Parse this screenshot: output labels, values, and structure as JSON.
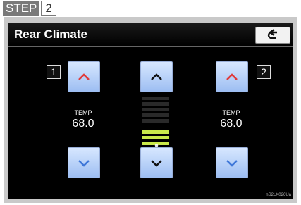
{
  "step": {
    "word": "STEP",
    "number": "2"
  },
  "header": {
    "title": "Rear Climate",
    "back_icon": "back-arrow-icon"
  },
  "left_zone": {
    "badge": "1",
    "temp_label": "TEMP",
    "temp_value": "68.0"
  },
  "right_zone": {
    "badge": "2",
    "temp_label": "TEMP",
    "temp_value": "68.0"
  },
  "fan": {
    "icon": "fan-icon",
    "level_fraction": 0.5
  },
  "image_code": "nS2LX026Ua",
  "colors": {
    "button_top": "#d7e7ff",
    "button_bottom": "#9dbef2",
    "red_arrow": "#e03a3a",
    "blue_arrow": "#3f77d8",
    "fan_bar": "#c9e84a"
  }
}
